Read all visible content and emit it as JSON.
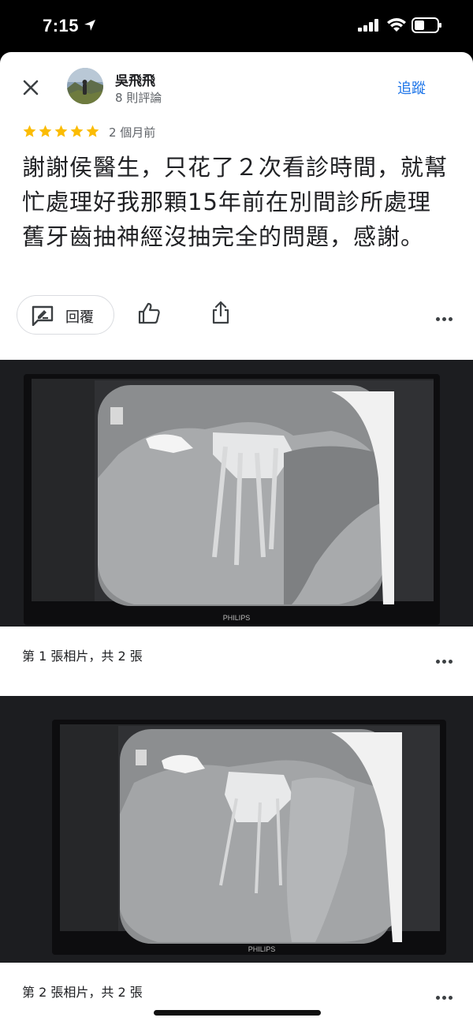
{
  "status_bar": {
    "time": "7:15"
  },
  "header": {
    "author_name": "吳飛飛",
    "review_count": "8 則評論",
    "follow_label": "追蹤"
  },
  "review": {
    "rating": 5,
    "date": "2 個月前",
    "text": "謝謝侯醫生，只花了２次看診時間，就幫忙處理好我那顆15年前在別間診所處理舊牙齒抽神經沒抽完全的問題，感謝。"
  },
  "actions": {
    "reply_label": "回覆"
  },
  "photos": [
    {
      "caption": "第 1 張相片，共 2 張"
    },
    {
      "caption": "第 2 張相片，共 2 張"
    }
  ],
  "colors": {
    "accent": "#1a73e8",
    "star": "#fbbc04",
    "text": "#202124",
    "secondary": "#5f6368"
  },
  "icons": [
    "close-icon",
    "star-icon",
    "reply-icon",
    "thumbs-up-icon",
    "share-icon",
    "more-icon"
  ]
}
